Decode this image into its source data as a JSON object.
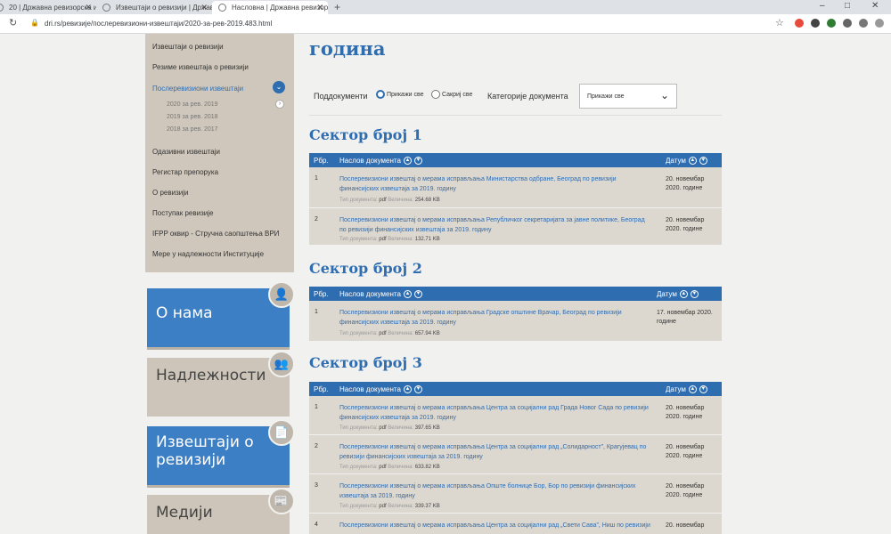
{
  "browser": {
    "tabs": [
      {
        "title": "20 | Државна ревизорска инс",
        "active": false
      },
      {
        "title": "Извештаји о ревизији | Држав",
        "active": false
      },
      {
        "title": "Насловна | Државна ревизор",
        "active": true
      }
    ],
    "new_tab": "+",
    "url": "dri.rs/ревизије/послеревизиони-извештаји/2020-за-рев-2019.483.html",
    "window_controls": [
      "–",
      "□",
      "✕"
    ],
    "nav": {
      "back": "←",
      "forward": "→",
      "reload": "↻",
      "lock": "🔒",
      "star": "☆"
    }
  },
  "page": {
    "title": "година",
    "filters": {
      "subdocs_label": "Поддокументи",
      "show_all": "Прикажи све",
      "hide_all": "Сакриј све",
      "categories_label": "Категорије документа",
      "category_value": "Прикажи све"
    }
  },
  "sidebar": {
    "items": [
      {
        "label": "Извештаји о ревизији"
      },
      {
        "label": "Резиме извештаја о ревизији"
      },
      {
        "label": "Послеревизиони извештаји"
      },
      {
        "label": "2020 за рев. 2019"
      },
      {
        "label": "2019 за рев. 2018"
      },
      {
        "label": "2018 за рев. 2017"
      },
      {
        "label": "Одазивни извештаји"
      },
      {
        "label": "Регистар препорука"
      },
      {
        "label": "О ревизији"
      },
      {
        "label": "Поступак ревизије"
      },
      {
        "label": "IFPP оквир - Стручна саопштења ВРИ"
      },
      {
        "label": "Мере у надлежности Институције"
      }
    ],
    "tiles": [
      {
        "label": "О нама",
        "icon": "👤"
      },
      {
        "label": "Надлежности",
        "icon": "👥"
      },
      {
        "label": "Извештаји о ревизији",
        "icon": "📄"
      },
      {
        "label": "Медији",
        "icon": "📰"
      }
    ]
  },
  "table_headers": {
    "num": "Рбр.",
    "title": "Наслов документа",
    "date": "Датум",
    "up": "▲",
    "down": "▼"
  },
  "meta_labels": {
    "type": "Тип документа:",
    "size": "Величина:"
  },
  "sectors": [
    {
      "title": "Сектор број 1",
      "rows": [
        {
          "num": "1",
          "title": "Послеревизиони извештај о мерама исправљања Министарства одбране, Београд по ревизији финансијских извештаја за 2019. годину",
          "type": "pdf",
          "size": "254.68 KB",
          "date": "20. новембар 2020. године"
        },
        {
          "num": "2",
          "title": "Послеревизиони извештај о мерама исправљања Републичког секретаријата за јавне политике, Београд по ревизији финансијских извештаја за 2019. годину",
          "type": "pdf",
          "size": "132.71 KB",
          "date": "20. новембар 2020. године"
        }
      ]
    },
    {
      "title": "Сектор број 2",
      "rows": [
        {
          "num": "1",
          "title": "Послеревизиони извештај о мерама исправљања Градске општине Врачар, Београд по ревизији финансијских извештаја за 2019. годину",
          "type": "pdf",
          "size": "657.94 KB",
          "date": "17. новембар 2020. године"
        }
      ]
    },
    {
      "title": "Сектор број 3",
      "rows": [
        {
          "num": "1",
          "title": "Послеревизиони извештај о мерама исправљања Центра за социјални рад Града Новог Сада по ревизији финансијских извештаја за 2019. годину",
          "type": "pdf",
          "size": "397.65 KB",
          "date": "20. новембар 2020. године"
        },
        {
          "num": "2",
          "title": "Послеревизиони извештај о мерама исправљања Центра за социјални рад „Солидарност”, Крагујевац по ревизији финансијских извештаја за 2019. годину",
          "type": "pdf",
          "size": "633.82 KB",
          "date": "20. новембар 2020. године"
        },
        {
          "num": "3",
          "title": "Послеревизиони извештај о мерама исправљања Опште болнице Бор, Бор по ревизији финансијских извештаја за 2019. годину",
          "type": "pdf",
          "size": "339.37 KB",
          "date": "20. новембар 2020. године"
        },
        {
          "num": "4",
          "title": "Послеревизиони извештај о мерама исправљања Центра за социјални рад „Свети Сава”, Ниш по ревизији",
          "type": "",
          "size": "",
          "date": "20. новембар"
        }
      ]
    }
  ]
}
